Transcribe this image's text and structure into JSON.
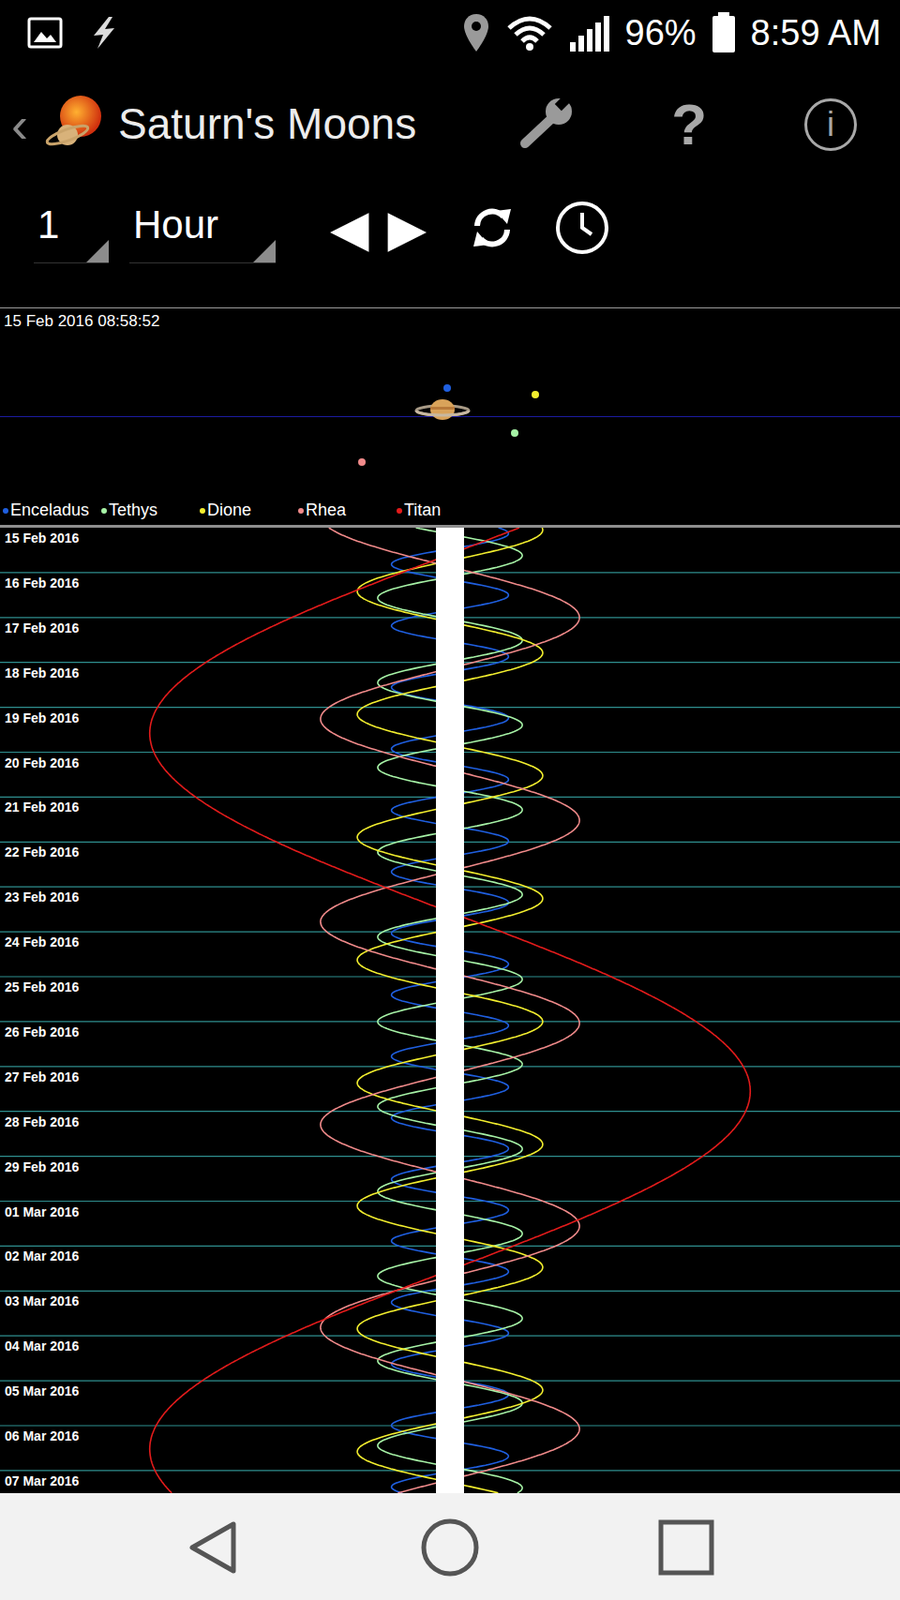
{
  "status_bar": {
    "battery": "96%",
    "time": "8:59 AM"
  },
  "app_bar": {
    "back": "‹",
    "title": "Saturn's Moons",
    "help": "?",
    "info": "i"
  },
  "controls": {
    "step_count": "1",
    "step_unit": "Hour",
    "prev": "◀",
    "next": "▶"
  },
  "sky_view": {
    "timestamp": "15 Feb 2016 08:58:52",
    "moons": [
      {
        "x": 0.34,
        "y": -1.5,
        "color": "#1f5fe0"
      },
      {
        "x": 4.9,
        "y": 1.5,
        "color": "#a6f2a6"
      },
      {
        "x": 6.28,
        "y": -1.1,
        "color": "#f2ee2e"
      },
      {
        "x": -5.45,
        "y": 3.5,
        "color": "#f08a8a"
      }
    ]
  },
  "chart": {
    "rows": [
      "15 Feb 2016",
      "16 Feb 2016",
      "17 Feb 2016",
      "18 Feb 2016",
      "19 Feb 2016",
      "20 Feb 2016",
      "21 Feb 2016",
      "22 Feb 2016",
      "23 Feb 2016",
      "24 Feb 2016",
      "25 Feb 2016",
      "26 Feb 2016",
      "27 Feb 2016",
      "28 Feb 2016",
      "29 Feb 2016",
      "01 Mar 2016",
      "02 Mar 2016",
      "03 Mar 2016",
      "04 Mar 2016",
      "05 Mar 2016",
      "06 Mar 2016",
      "07 Mar 2016"
    ],
    "series": [
      {
        "label": "Enceladus",
        "color": "#1f5fe0",
        "amplitude": 3.95,
        "period_days": 1.37,
        "peak_day": 0.13
      },
      {
        "label": "Tethys",
        "color": "#a6f2a6",
        "amplitude": 4.88,
        "period_days": 1.888,
        "peak_day": 0.62
      },
      {
        "label": "Dione",
        "color": "#f2ee2e",
        "amplitude": 6.26,
        "period_days": 2.737,
        "peak_day": 0.05
      },
      {
        "label": "Rhea",
        "color": "#f08a8a",
        "amplitude": 8.74,
        "period_days": 4.518,
        "peak_day": 2.0
      },
      {
        "label": "Titan",
        "color": "#e31b1b",
        "amplitude": 20.27,
        "period_days": 15.945,
        "peak_day": 12.55
      }
    ]
  }
}
